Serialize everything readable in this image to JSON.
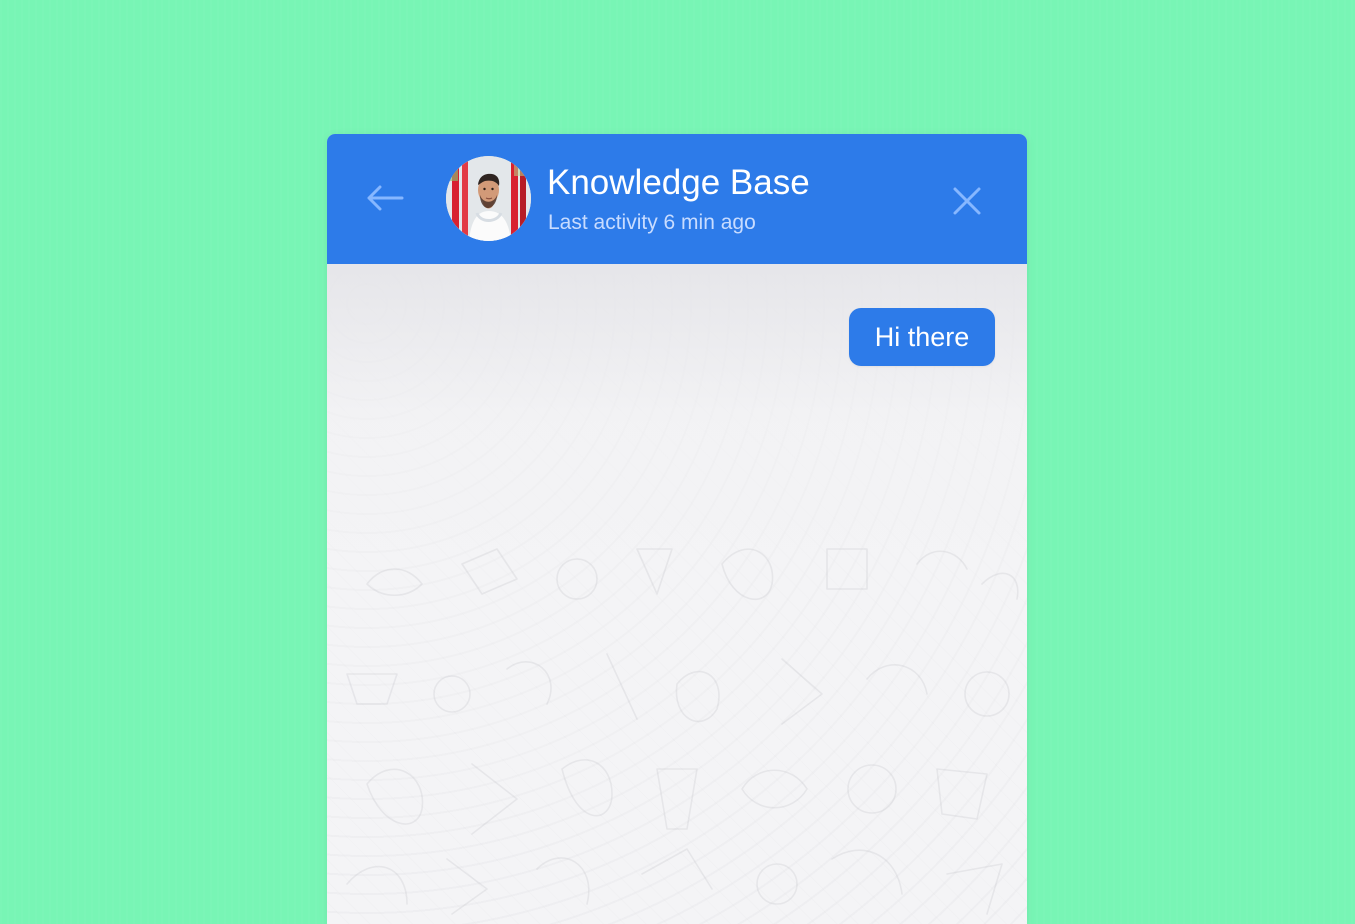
{
  "chat": {
    "title": "Knowledge Base",
    "subtitle": "Last activity 6 min ago",
    "icons": {
      "back": "back-arrow-icon",
      "close": "close-icon",
      "avatar": "person-avatar"
    },
    "messages": [
      {
        "text": "Hi there",
        "from": "user"
      }
    ]
  },
  "colors": {
    "background": "#78f5b5",
    "header": "#2d7be9",
    "bubble": "#2d7be9",
    "chat_background": "#f1f1f3"
  }
}
